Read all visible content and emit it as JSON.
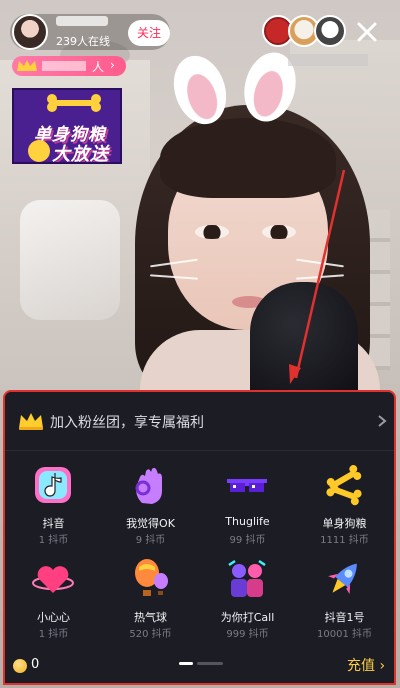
{
  "header": {
    "viewer_count": "239人在线",
    "follow_label": "关注",
    "close_glyph": "✕"
  },
  "fan_badge": {
    "suffix_text": "人",
    "chevron": "›"
  },
  "promo_banner": {
    "line1": "单身狗粮",
    "line2": "大放送"
  },
  "gift_panel": {
    "fan_club_text": "加入粉丝团，享专属福利",
    "gifts": [
      {
        "name": "抖音",
        "price": "1 抖币",
        "icon": "tiktok-note-icon"
      },
      {
        "name": "我觉得OK",
        "price": "9 抖币",
        "icon": "ok-hand-icon"
      },
      {
        "name": "Thuglife",
        "price": "99 抖币",
        "icon": "pixel-sunglasses-icon"
      },
      {
        "name": "单身狗粮",
        "price": "1111 抖币",
        "icon": "dog-bones-icon"
      },
      {
        "name": "小心心",
        "price": "1 抖币",
        "icon": "heart-icon"
      },
      {
        "name": "热气球",
        "price": "520 抖币",
        "icon": "hot-air-balloon-icon"
      },
      {
        "name": "为你打Call",
        "price": "999 抖币",
        "icon": "cheer-call-icon"
      },
      {
        "name": "抖音1号",
        "price": "10001 抖币",
        "icon": "rocket-icon"
      }
    ],
    "balance": "0",
    "recharge_label": "充值 ›"
  },
  "colors": {
    "accent_red": "#fe2c55",
    "panel_bg": "#1c1c24",
    "recharge_yellow": "#facd41",
    "annotation_red": "#e0312e"
  }
}
